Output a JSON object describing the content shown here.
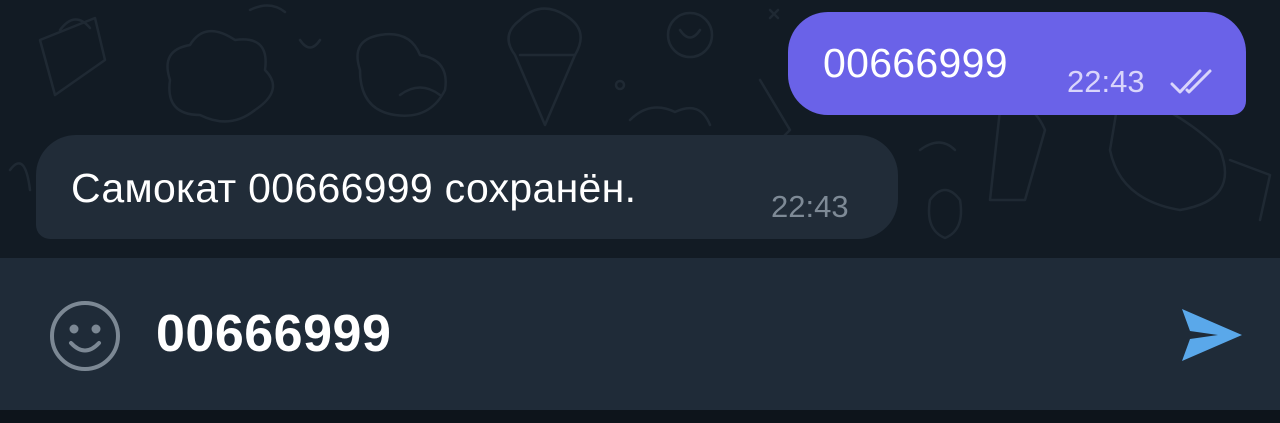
{
  "chat": {
    "messages": [
      {
        "direction": "outgoing",
        "text": "00666999",
        "time": "22:43",
        "status_icon": "double-check-icon"
      },
      {
        "direction": "incoming",
        "text": "Самокат 00666999 сохранён.",
        "time": "22:43"
      }
    ]
  },
  "composer": {
    "value": "00666999",
    "emoji_icon": "smiley-icon",
    "send_icon": "send-icon"
  },
  "colors": {
    "chat_background": "#121b24",
    "outgoing_bubble": "#6a62e8",
    "incoming_bubble": "#212c38",
    "input_bar": "#1f2b38",
    "send_accent": "#5aa8ea"
  }
}
